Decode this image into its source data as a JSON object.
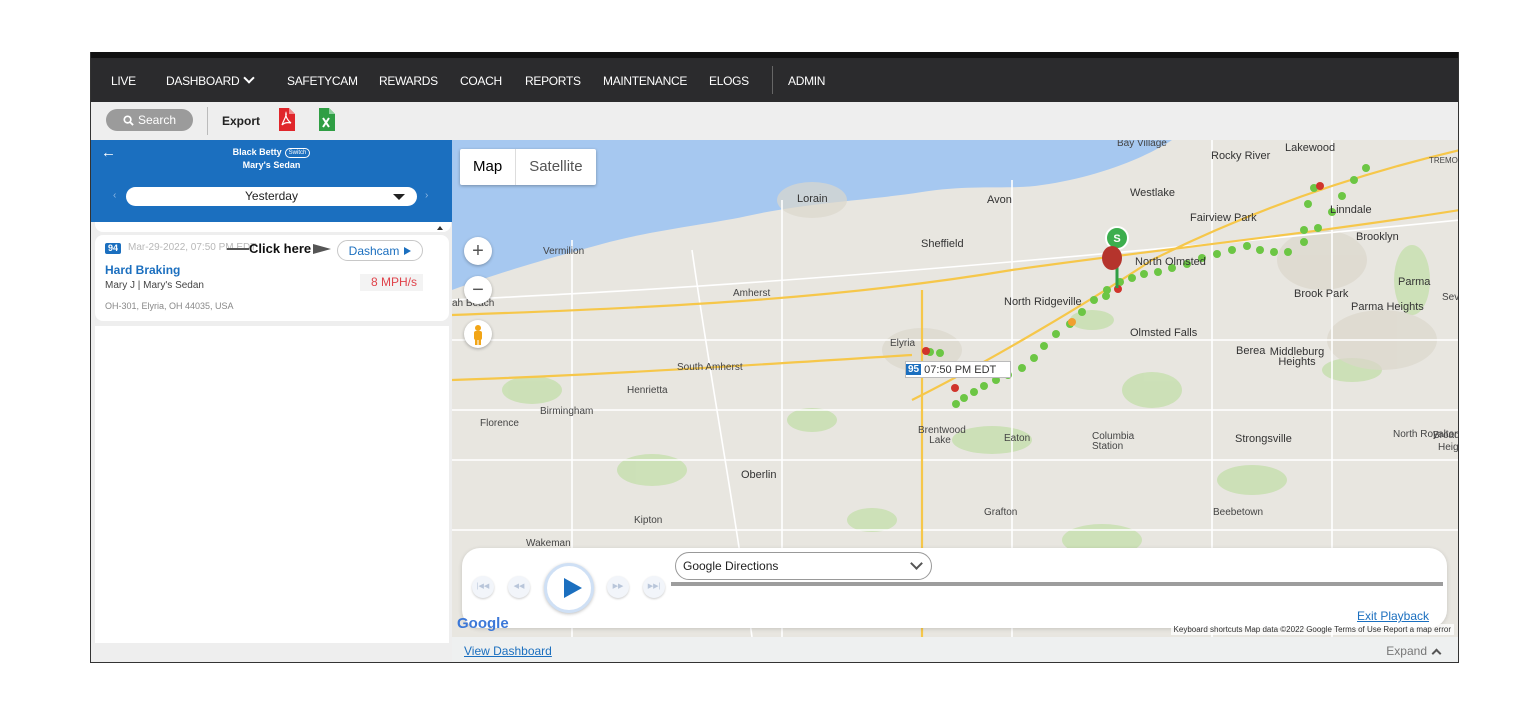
{
  "nav": {
    "items": [
      {
        "label": "LIVE"
      },
      {
        "label": "DASHBOARD"
      },
      {
        "label": "SAFETYCAM"
      },
      {
        "label": "REWARDS"
      },
      {
        "label": "COACH"
      },
      {
        "label": "REPORTS"
      },
      {
        "label": "MAINTENANCE"
      },
      {
        "label": "ELOGS"
      },
      {
        "label": "ADMIN"
      }
    ]
  },
  "toolbar": {
    "search_label": "Search",
    "export_label": "Export",
    "pdf_icon": "pdf-icon",
    "excel_icon": "excel-icon",
    "pdf_color": "#e0262b",
    "excel_color": "#2f9e44"
  },
  "vehicle_panel": {
    "driver": "Black Betty",
    "switch_label": "Switch",
    "vehicle": "Mary's Sedan",
    "date_selected": "Yesterday",
    "header_color": "#1b6fbf"
  },
  "event": {
    "badge": "94",
    "time": "Mar-29-2022, 07:50 PM EDT",
    "annotation": "Click here",
    "dashcam_label": "Dashcam",
    "type": "Hard Braking",
    "driver_vehicle": "Mary J | Mary's Sedan",
    "speed": "8 MPH/s",
    "address": "OH-301, Elyria, OH 44035, USA"
  },
  "map": {
    "type_tabs": [
      "Map",
      "Satellite"
    ],
    "zoom_in": "+",
    "zoom_out": "−",
    "tooltip_badge": "95",
    "tooltip_time": "07:50 PM EDT",
    "start_marker": "S",
    "places": [
      "Bay Village",
      "Lakewood",
      "Rocky River",
      "Westlake",
      "Fairview Park",
      "Linndale",
      "Lorain",
      "Avon",
      "Sheffield",
      "Vermilion",
      "North Olmsted",
      "Brooklyn",
      "Amherst",
      "North Ridgeville",
      "Brook Park",
      "Parma",
      "Parma Heights",
      "Olmsted Falls",
      "Elyria",
      "Berea",
      "Middleburg Heights",
      "South Amherst",
      "Henrietta",
      "Birmingham",
      "Florence",
      "Brentwood Lake",
      "Eaton",
      "Columbia Station",
      "Strongsville",
      "North Royalton",
      "Oberlin",
      "Grafton",
      "Beebetown",
      "Kipton",
      "Wakeman",
      "Sev",
      "Broad",
      "Heig",
      "TREMO",
      "ah Beach"
    ],
    "footer": "Keyboard shortcuts   Map data ©2022 Google   Terms of Use   Report a map error",
    "google_logo": "Google",
    "route_color": "#6cc644",
    "event_color": "#d0342c"
  },
  "playback": {
    "directions_label": "Google Directions",
    "exit_label": "Exit Playback"
  },
  "bottom": {
    "view_dashboard": "View Dashboard",
    "expand": "Expand"
  }
}
